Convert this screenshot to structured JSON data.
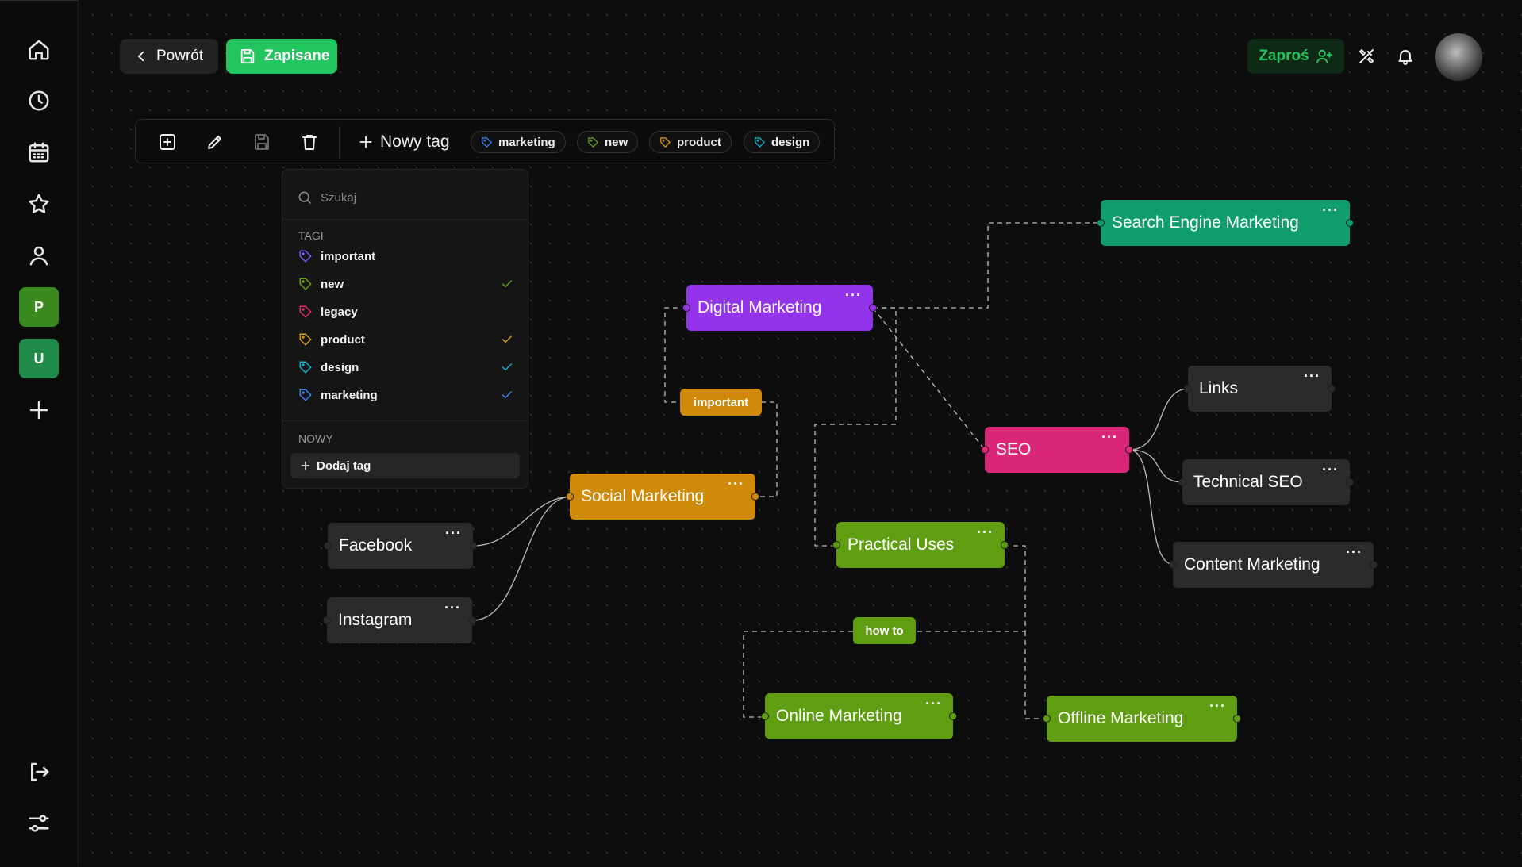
{
  "header": {
    "back_label": "Powrót",
    "saved_label": "Zapisane",
    "invite_label": "Zaproś"
  },
  "sidebar": {
    "workspaces": [
      {
        "letter": "P",
        "color": "#2f8a2a"
      },
      {
        "letter": "U",
        "color": "#1f8a4a"
      }
    ]
  },
  "toolbar": {
    "new_tag_label": "Nowy tag",
    "tags": [
      {
        "name": "marketing",
        "color": "#3b82f6"
      },
      {
        "name": "new",
        "color": "#65a30d"
      },
      {
        "name": "product",
        "color": "#d99a13"
      },
      {
        "name": "design",
        "color": "#06b6d4"
      }
    ]
  },
  "dropdown": {
    "search_placeholder": "Szukaj",
    "tags_heading": "TAGI",
    "items": [
      {
        "name": "important",
        "color": "#6d5df6",
        "checked": false
      },
      {
        "name": "new",
        "color": "#65a30d",
        "checked": true
      },
      {
        "name": "legacy",
        "color": "#e0286e",
        "checked": false
      },
      {
        "name": "product",
        "color": "#d99a13",
        "checked": true
      },
      {
        "name": "design",
        "color": "#06b6d4",
        "checked": true
      },
      {
        "name": "marketing",
        "color": "#3b82f6",
        "checked": true
      }
    ],
    "new_heading": "NOWY",
    "add_tag_label": "Dodaj tag"
  },
  "canvas": {
    "menu_glyph": "···",
    "nodes": {
      "search_engine_marketing": {
        "label": "Search Engine Marketing",
        "color": "#0f9d6e"
      },
      "digital_marketing": {
        "label": "Digital Marketing",
        "color": "#9333ea"
      },
      "links": {
        "label": "Links",
        "color": "#2b2b2b"
      },
      "seo": {
        "label": "SEO",
        "color": "#db2777"
      },
      "technical_seo": {
        "label": "Technical SEO",
        "color": "#2b2b2b"
      },
      "social_marketing": {
        "label": "Social Marketing",
        "color": "#d08a0a"
      },
      "practical_uses": {
        "label": "Practical Uses",
        "color": "#5f9e10"
      },
      "content_marketing": {
        "label": "Content Marketing",
        "color": "#2b2b2b"
      },
      "facebook": {
        "label": "Facebook",
        "color": "#2b2b2b"
      },
      "instagram": {
        "label": "Instagram",
        "color": "#2b2b2b"
      },
      "online_marketing": {
        "label": "Online Marketing",
        "color": "#5f9e10"
      },
      "offline_marketing": {
        "label": "Offline Marketing",
        "color": "#5f9e10"
      }
    },
    "edge_labels": {
      "important": {
        "label": "important",
        "color": "#d08a0a"
      },
      "how_to": {
        "label": "how to",
        "color": "#5f9e10"
      }
    }
  }
}
